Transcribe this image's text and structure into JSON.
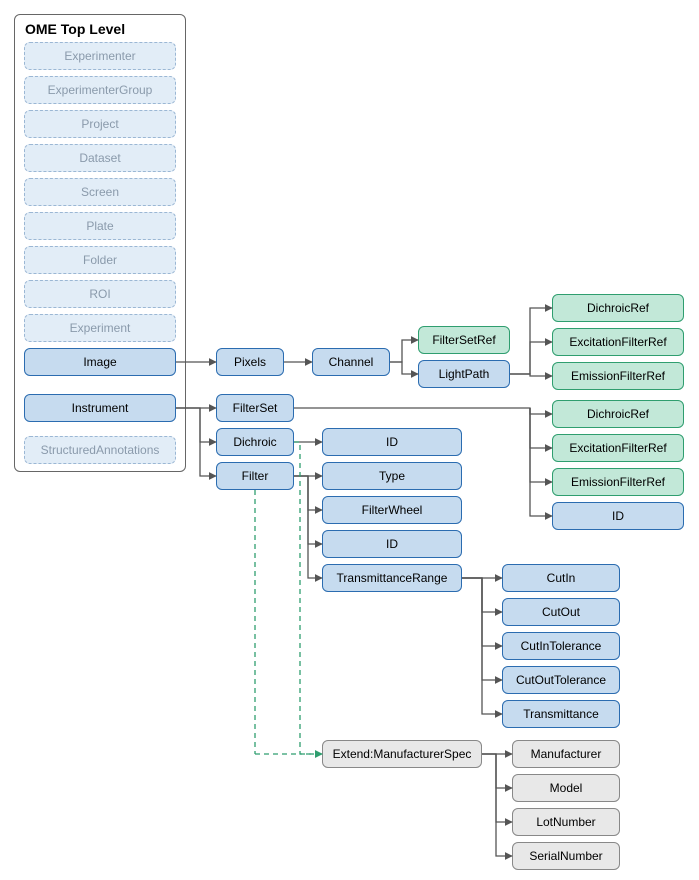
{
  "container_title": "OME Top Level",
  "top_level": {
    "experimenter": "Experimenter",
    "experimenter_group": "ExperimenterGroup",
    "project": "Project",
    "dataset": "Dataset",
    "screen": "Screen",
    "plate": "Plate",
    "folder": "Folder",
    "roi": "ROI",
    "experiment": "Experiment",
    "image": "Image",
    "instrument": "Instrument",
    "structured_annotations": "StructuredAnnotations"
  },
  "mid": {
    "pixels": "Pixels",
    "channel": "Channel",
    "filterset_ref": "FilterSetRef",
    "lightpath": "LightPath",
    "lightpath_children": {
      "dichroic_ref": "DichroicRef",
      "excitation_filter_ref": "ExcitationFilterRef",
      "emission_filter_ref": "EmissionFilterRef"
    },
    "filterset": "FilterSet",
    "filterset_children": {
      "dichroic_ref": "DichroicRef",
      "excitation_filter_ref": "ExcitationFilterRef",
      "emission_filter_ref": "EmissionFilterRef",
      "id": "ID"
    },
    "dichroic": "Dichroic",
    "dichroic_id": "ID",
    "filter": "Filter",
    "filter_children": {
      "type": "Type",
      "filterwheel": "FilterWheel",
      "id": "ID",
      "transmittance_range": "TransmittanceRange"
    },
    "transmittance_children": {
      "cutin": "CutIn",
      "cutout": "CutOut",
      "cutin_tolerance": "CutInTolerance",
      "cutout_tolerance": "CutOutTolerance",
      "transmittance": "Transmittance"
    },
    "extend_mfr": "Extend:ManufacturerSpec",
    "mfr_children": {
      "manufacturer": "Manufacturer",
      "model": "Model",
      "lot_number": "LotNumber",
      "serial_number": "SerialNumber"
    }
  }
}
